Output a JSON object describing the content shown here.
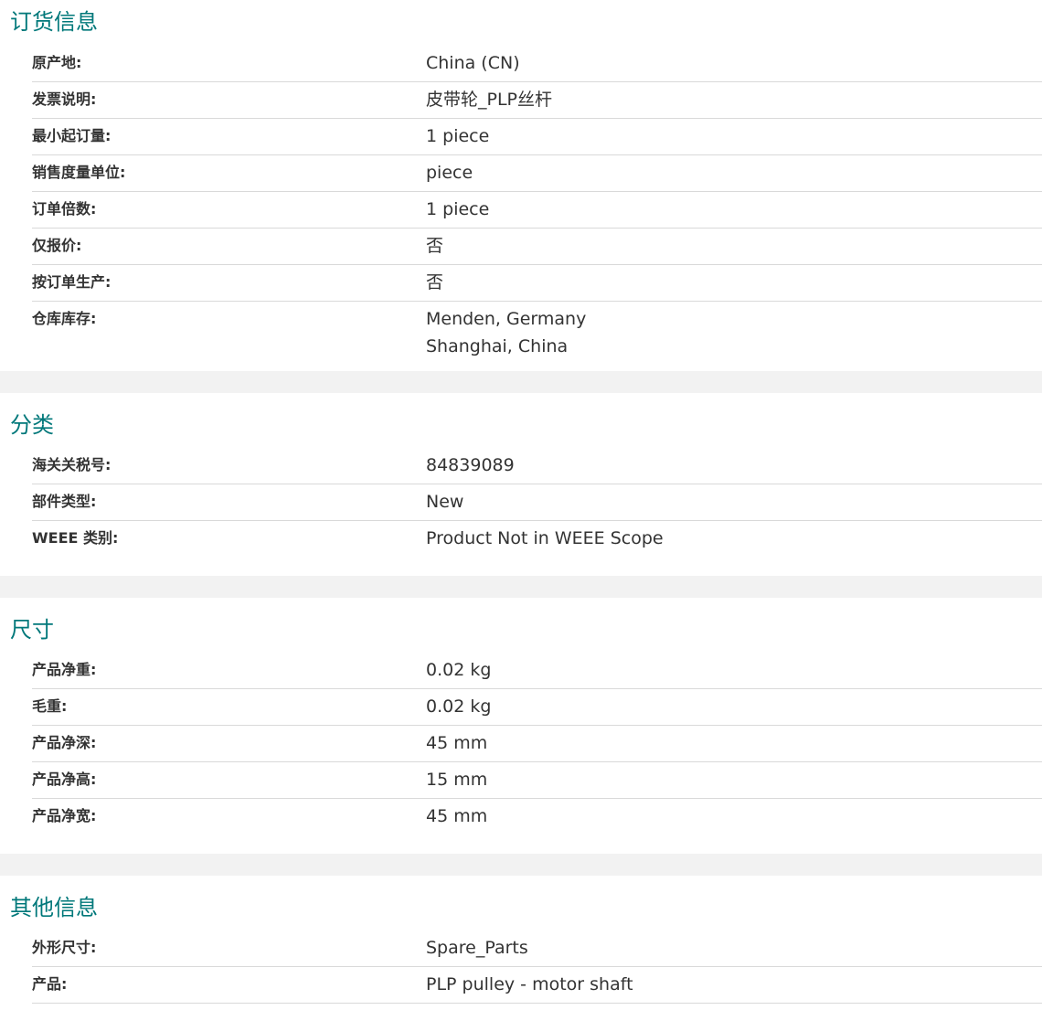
{
  "sections": [
    {
      "title": "订货信息",
      "rows": [
        {
          "label": "原产地:",
          "value": "China (CN)"
        },
        {
          "label": "发票说明:",
          "value": "皮带轮_PLP丝杆"
        },
        {
          "label": "最小起订量:",
          "value": "1 piece"
        },
        {
          "label": "销售度量单位:",
          "value": "piece"
        },
        {
          "label": "订单倍数:",
          "value": "1 piece"
        },
        {
          "label": "仅报价:",
          "value": "否"
        },
        {
          "label": "按订单生产:",
          "value": "否"
        },
        {
          "label": "仓库库存:",
          "values": [
            "Menden, Germany",
            "Shanghai, China"
          ]
        }
      ]
    },
    {
      "title": "分类",
      "rows": [
        {
          "label": "海关关税号:",
          "value": "84839089"
        },
        {
          "label": "部件类型:",
          "value": "New"
        },
        {
          "label": "WEEE 类别:",
          "value": "Product Not in WEEE Scope"
        }
      ]
    },
    {
      "title": "尺寸",
      "rows": [
        {
          "label": "产品净重:",
          "value": "0.02 kg"
        },
        {
          "label": "毛重:",
          "value": "0.02 kg"
        },
        {
          "label": "产品净深:",
          "value": "45 mm"
        },
        {
          "label": "产品净高:",
          "value": "15 mm"
        },
        {
          "label": "产品净宽:",
          "value": "45 mm"
        }
      ]
    },
    {
      "title": "其他信息",
      "rows": [
        {
          "label": "外形尺寸:",
          "value": "Spare_Parts"
        },
        {
          "label": "产品:",
          "value": "PLP pulley - motor shaft"
        }
      ]
    }
  ],
  "colors": {
    "title": "#00787a",
    "text": "#333333",
    "divider": "#d9d9d9",
    "gap": "#f2f2f2"
  }
}
